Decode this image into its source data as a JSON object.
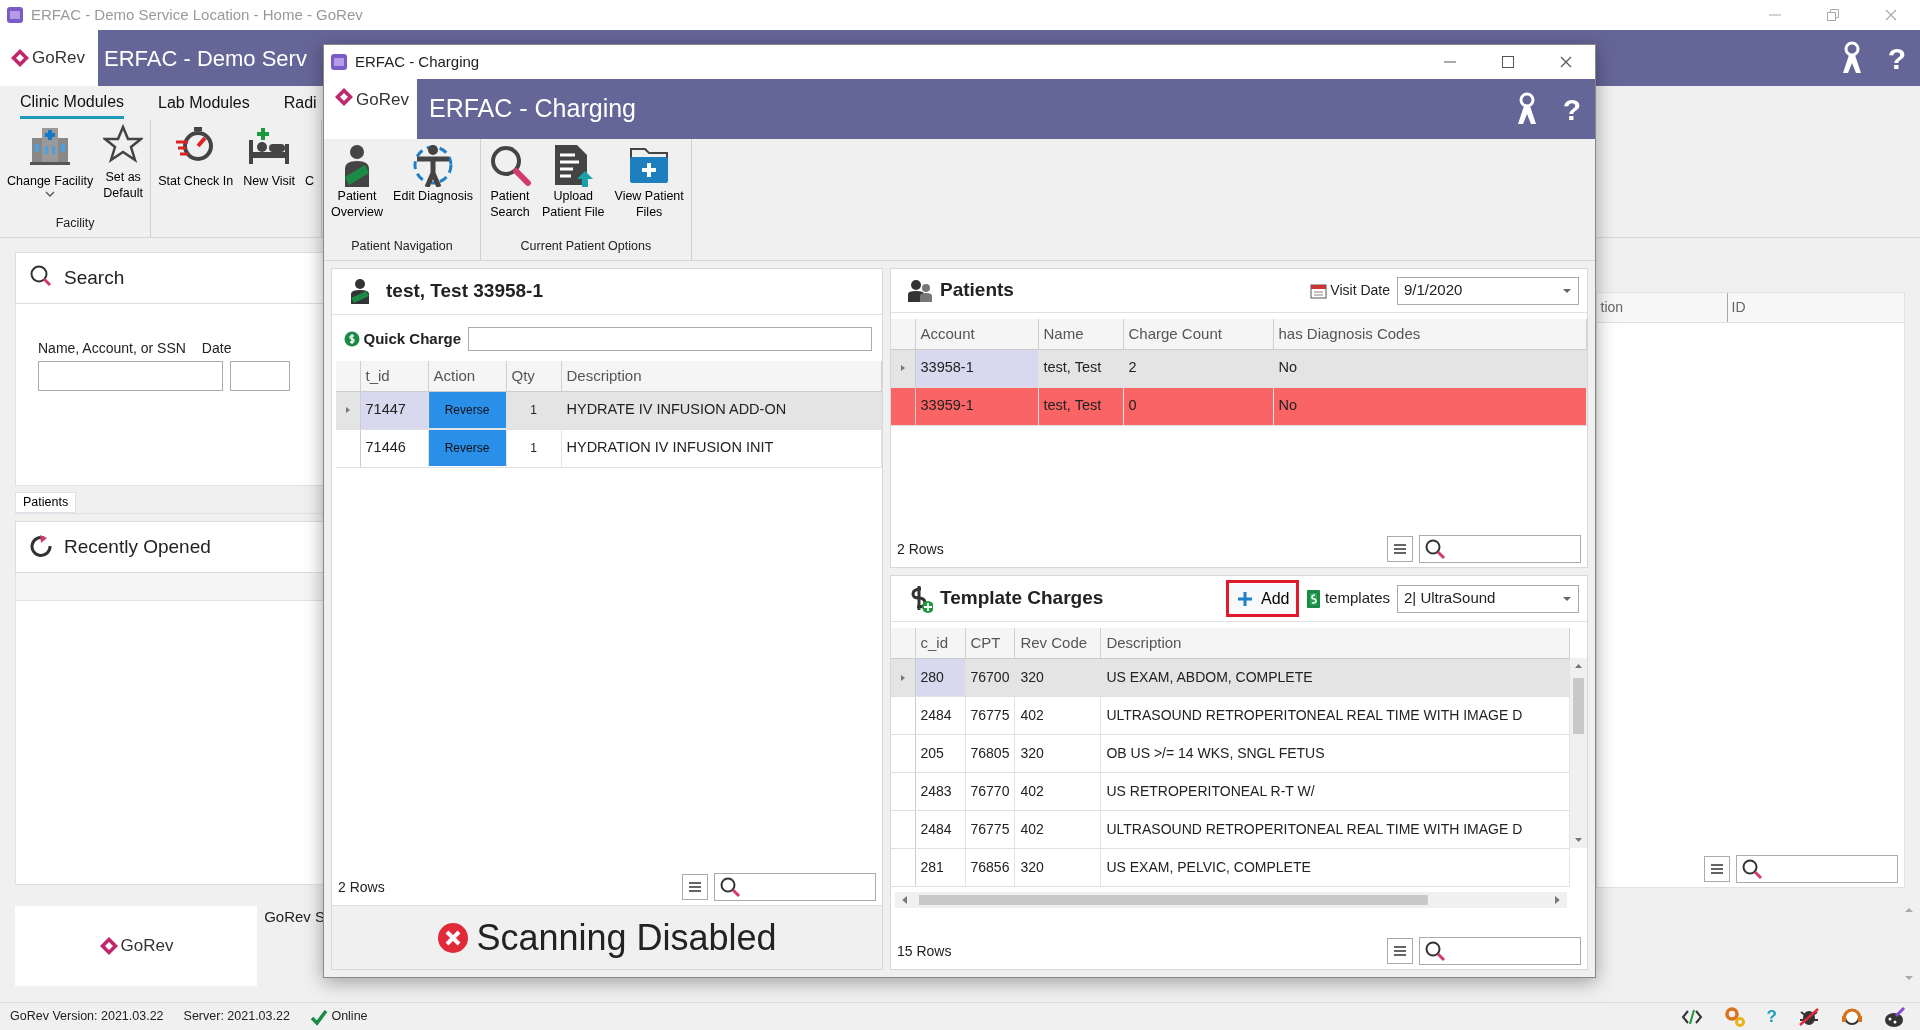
{
  "main_window": {
    "title": "ERFAC - Demo Service Location - Home - GoRev",
    "logo": "GoRev",
    "header_title": "ERFAC - Demo Serv",
    "help": "?",
    "ribbon_tabs": [
      {
        "label": "Clinic Modules",
        "selected": true
      },
      {
        "label": "Lab Modules",
        "selected": false
      },
      {
        "label": "Radi",
        "selected": false
      }
    ],
    "ribbon_groups": [
      {
        "label": "Facility",
        "buttons": [
          {
            "label": "Change Facility",
            "dropdown": true
          },
          {
            "label": "Set as\nDefault",
            "dropdown": false
          }
        ]
      },
      {
        "buttons": [
          {
            "label": "Stat Check In",
            "dropdown": false
          },
          {
            "label": "New Visit",
            "dropdown": false
          },
          {
            "label": "C",
            "dropdown": false
          }
        ]
      }
    ],
    "search": {
      "title": "Search",
      "field_label": "Name, Account, or SSN",
      "date_label": "Date"
    },
    "bottom_tabs": [
      {
        "label": "Patients",
        "selected": true
      }
    ],
    "recently_opened": {
      "title": "Recently Opened"
    },
    "footer": {
      "logo": "GoRev",
      "text": "GoRev S"
    },
    "right_table": {
      "columns": [
        "tion",
        "ID"
      ]
    }
  },
  "status_bar": {
    "version": "GoRev Version: 2021.03.22",
    "server": "Server: 2021.03.22",
    "connection": "Online",
    "help": "?"
  },
  "dialog": {
    "title": "ERFAC - Charging",
    "logo": "GoRev",
    "header_title": "ERFAC - Charging",
    "help": "?",
    "ribbon_groups": [
      {
        "label": "Patient Navigation",
        "buttons": [
          {
            "label": "Patient\nOverview"
          },
          {
            "label": "Edit Diagnosis"
          }
        ]
      },
      {
        "label": "Current Patient Options",
        "buttons": [
          {
            "label": "Patient\nSearch"
          },
          {
            "label": "Upload\nPatient File"
          },
          {
            "label": "View Patient\nFiles"
          }
        ]
      }
    ],
    "patient": {
      "title": "test, Test 33958-1",
      "quick_charge_label": "Quick Charge",
      "columns": [
        "t_id",
        "Action",
        "Qty",
        "Description"
      ],
      "rows": [
        {
          "t_id": "71447",
          "action": "Reverse",
          "qty": "1",
          "description": "HYDRATE IV INFUSION ADD-ON",
          "selected": true
        },
        {
          "t_id": "71446",
          "action": "Reverse",
          "qty": "1",
          "description": "HYDRATION IV INFUSION INIT",
          "selected": false
        }
      ],
      "row_count": "2 Rows",
      "scanning": "Scanning Disabled"
    },
    "patients": {
      "title": "Patients",
      "visit_date_label": "Visit Date",
      "visit_date": "9/1/2020",
      "columns": [
        "Account",
        "Name",
        "Charge Count",
        "has Diagnosis Codes"
      ],
      "rows": [
        {
          "account": "33958-1",
          "name": "test, Test",
          "charge_count": "2",
          "has_diagnosis": "No",
          "selected": true,
          "flagged": false
        },
        {
          "account": "33959-1",
          "name": "test, Test",
          "charge_count": "0",
          "has_diagnosis": "No",
          "selected": false,
          "flagged": true
        }
      ],
      "row_count": "2 Rows"
    },
    "template_charges": {
      "title": "Template Charges",
      "add_button": {
        "label": "Add",
        "highlighted": true
      },
      "templates_label": "templates",
      "template": "2| UltraSound",
      "columns": [
        "c_id",
        "CPT",
        "Rev Code",
        "Description"
      ],
      "rows": [
        {
          "c_id": "280",
          "cpt": "76700",
          "rev_code": "320",
          "description": "US EXAM, ABDOM, COMPLETE",
          "selected": true
        },
        {
          "c_id": "2484",
          "cpt": "76775",
          "rev_code": "402",
          "description": "ULTRASOUND RETROPERITONEAL REAL TIME WITH IMAGE D",
          "selected": false
        },
        {
          "c_id": "205",
          "cpt": "76805",
          "rev_code": "320",
          "description": "OB US >/= 14 WKS, SNGL FETUS",
          "selected": false
        },
        {
          "c_id": "2483",
          "cpt": "76770",
          "rev_code": "402",
          "description": "US RETROPERITONEAL R-T W/",
          "selected": false
        },
        {
          "c_id": "2484",
          "cpt": "76775",
          "rev_code": "402",
          "description": "ULTRASOUND RETROPERITONEAL REAL TIME WITH IMAGE D",
          "selected": false
        },
        {
          "c_id": "281",
          "cpt": "76856",
          "rev_code": "320",
          "description": "US EXAM, PELVIC, COMPLETE",
          "selected": false
        }
      ],
      "row_count": "15 Rows"
    }
  }
}
